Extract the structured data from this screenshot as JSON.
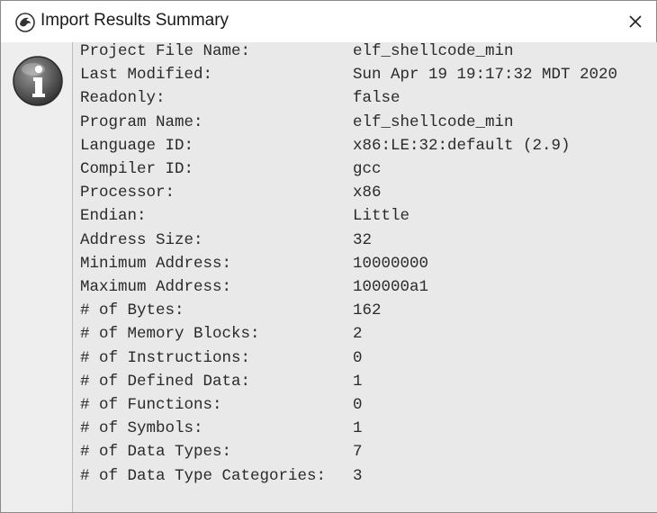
{
  "dialog": {
    "title": "Import Results Summary",
    "close_glyph": "×"
  },
  "icons": {
    "app": "ghidra-dragon-icon",
    "close": "close-icon",
    "info": "info-icon"
  },
  "summary": {
    "rows": [
      {
        "label": "Project File Name:",
        "value": "elf_shellcode_min"
      },
      {
        "label": "Last Modified:",
        "value": "Sun Apr 19 19:17:32 MDT 2020"
      },
      {
        "label": "Readonly:",
        "value": "false"
      },
      {
        "label": "Program Name:",
        "value": "elf_shellcode_min"
      },
      {
        "label": "Language ID:",
        "value": "x86:LE:32:default (2.9)"
      },
      {
        "label": "Compiler ID:",
        "value": "gcc"
      },
      {
        "label": "Processor:",
        "value": "x86"
      },
      {
        "label": "Endian:",
        "value": "Little"
      },
      {
        "label": "Address Size:",
        "value": "32"
      },
      {
        "label": "Minimum Address:",
        "value": "10000000"
      },
      {
        "label": "Maximum Address:",
        "value": "100000a1"
      },
      {
        "label": "# of Bytes:",
        "value": "162"
      },
      {
        "label": "# of Memory Blocks:",
        "value": "2"
      },
      {
        "label": "# of Instructions:",
        "value": "0"
      },
      {
        "label": "# of Defined Data:",
        "value": "1"
      },
      {
        "label": "# of Functions:",
        "value": "0"
      },
      {
        "label": "# of Symbols:",
        "value": "1"
      },
      {
        "label": "# of Data Types:",
        "value": "7"
      },
      {
        "label": "# of Data Type Categories:",
        "value": "3"
      }
    ]
  }
}
